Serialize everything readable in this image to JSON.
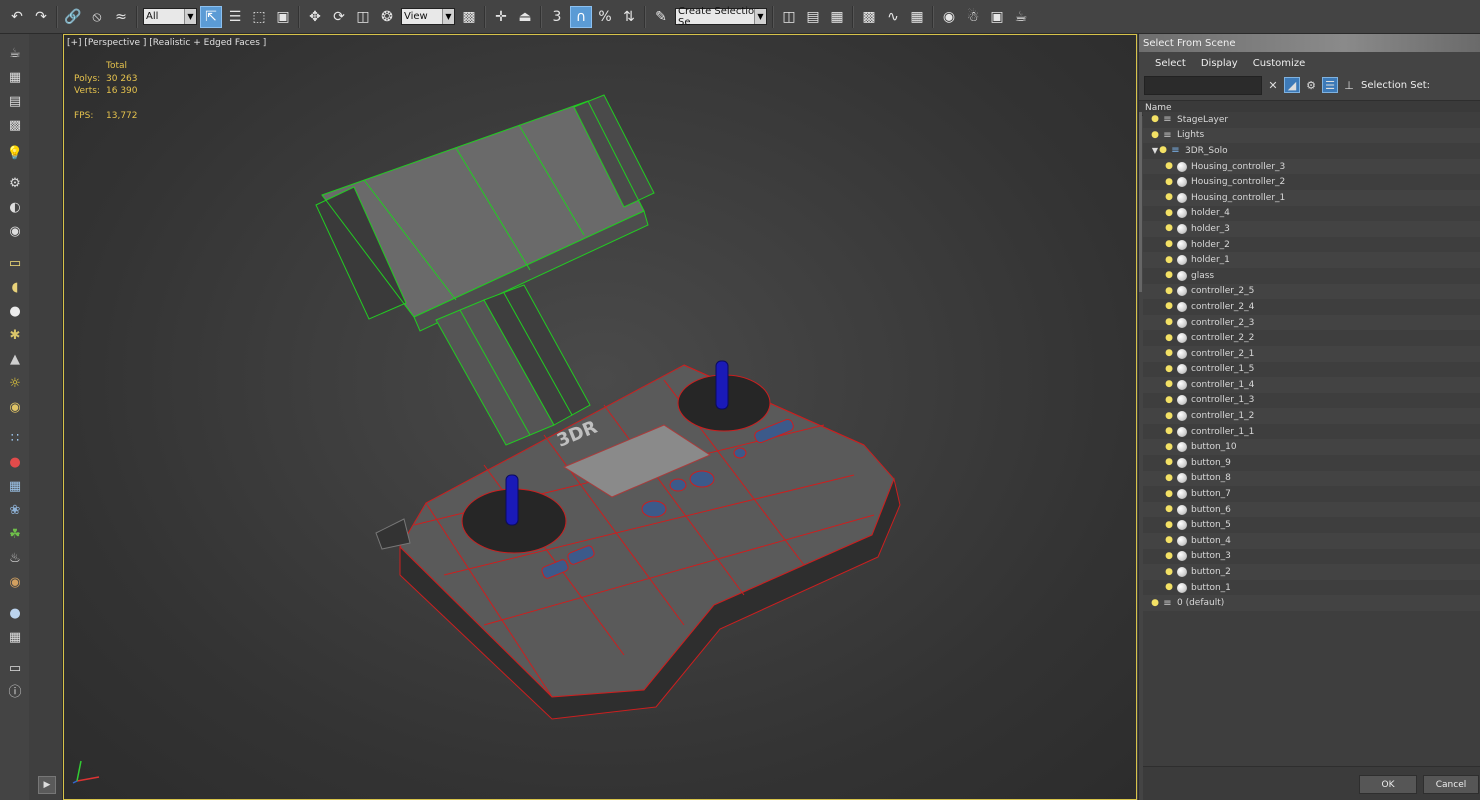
{
  "toolbar": {
    "filter_value": "All",
    "refcoord_value": "View",
    "named_selection_placeholder": "Create Selection Se",
    "snap_angle_label": "3"
  },
  "viewport": {
    "label": "[+] [Perspective ] [Realistic + Edged Faces ]",
    "stats": {
      "header": "Total",
      "polys_label": "Polys:",
      "polys_value": "30 263",
      "verts_label": "Verts:",
      "verts_value": "16 390",
      "fps_label": "FPS:",
      "fps_value": "13,772"
    },
    "model_logo": "3DR"
  },
  "dialog": {
    "title": "Select From Scene",
    "menu": [
      "Select",
      "Display",
      "Customize"
    ],
    "selection_set_label": "Selection Set:",
    "column_name": "Name",
    "tree": [
      {
        "label": "StageLayer",
        "kind": "layer",
        "depth": 0
      },
      {
        "label": "Lights",
        "kind": "layer",
        "depth": 0
      },
      {
        "label": "3DR_Solo",
        "kind": "layer-active",
        "depth": 0,
        "expanded": true
      },
      {
        "label": "Housing_controller_3",
        "kind": "object",
        "depth": 1
      },
      {
        "label": "Housing_controller_2",
        "kind": "object",
        "depth": 1
      },
      {
        "label": "Housing_controller_1",
        "kind": "object",
        "depth": 1
      },
      {
        "label": "holder_4",
        "kind": "object",
        "depth": 1
      },
      {
        "label": "holder_3",
        "kind": "object",
        "depth": 1
      },
      {
        "label": "holder_2",
        "kind": "object",
        "depth": 1
      },
      {
        "label": "holder_1",
        "kind": "object",
        "depth": 1
      },
      {
        "label": "glass",
        "kind": "object",
        "depth": 1
      },
      {
        "label": "controller_2_5",
        "kind": "object",
        "depth": 1
      },
      {
        "label": "controller_2_4",
        "kind": "object",
        "depth": 1
      },
      {
        "label": "controller_2_3",
        "kind": "object",
        "depth": 1
      },
      {
        "label": "controller_2_2",
        "kind": "object",
        "depth": 1
      },
      {
        "label": "controller_2_1",
        "kind": "object",
        "depth": 1
      },
      {
        "label": "controller_1_5",
        "kind": "object",
        "depth": 1
      },
      {
        "label": "controller_1_4",
        "kind": "object",
        "depth": 1
      },
      {
        "label": "controller_1_3",
        "kind": "object",
        "depth": 1
      },
      {
        "label": "controller_1_2",
        "kind": "object",
        "depth": 1
      },
      {
        "label": "controller_1_1",
        "kind": "object",
        "depth": 1
      },
      {
        "label": "button_10",
        "kind": "object",
        "depth": 1
      },
      {
        "label": "button_9",
        "kind": "object",
        "depth": 1
      },
      {
        "label": "button_8",
        "kind": "object",
        "depth": 1
      },
      {
        "label": "button_7",
        "kind": "object",
        "depth": 1
      },
      {
        "label": "button_6",
        "kind": "object",
        "depth": 1
      },
      {
        "label": "button_5",
        "kind": "object",
        "depth": 1
      },
      {
        "label": "button_4",
        "kind": "object",
        "depth": 1
      },
      {
        "label": "button_3",
        "kind": "object",
        "depth": 1
      },
      {
        "label": "button_2",
        "kind": "object",
        "depth": 1
      },
      {
        "label": "button_1",
        "kind": "object",
        "depth": 1
      },
      {
        "label": "0 (default)",
        "kind": "layer",
        "depth": 0
      }
    ],
    "ok_label": "OK",
    "cancel_label": "Cancel"
  },
  "colors": {
    "viewport_border": "#d7c34a",
    "stats_text": "#e5c24d",
    "wire_red": "#cc1f1f",
    "wire_green": "#22cc22",
    "active_blue": "#5b9bd5"
  }
}
